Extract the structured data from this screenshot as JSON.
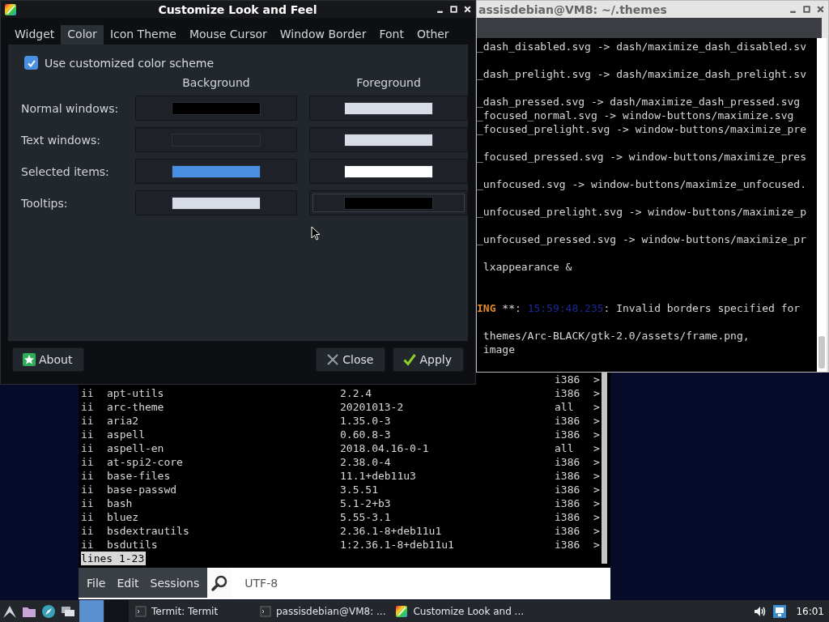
{
  "terminal_back": {
    "title": "assisdebian@VM8: ~/.themes",
    "lines": [
      {
        "kind": "text",
        "text": "_dash_disabled.svg -> dash/maximize_dash_disabled.sv"
      },
      {
        "kind": "blank"
      },
      {
        "kind": "text",
        "text": "_dash_prelight.svg -> dash/maximize_dash_prelight.sv"
      },
      {
        "kind": "blank"
      },
      {
        "kind": "text",
        "text": "_dash_pressed.svg -> dash/maximize_dash_pressed.svg"
      },
      {
        "kind": "text",
        "text": "_focused_normal.svg -> window-buttons/maximize.svg"
      },
      {
        "kind": "text",
        "text": "_focused_prelight.svg -> window-buttons/maximize_pre"
      },
      {
        "kind": "blank"
      },
      {
        "kind": "text",
        "text": "_focused_pressed.svg -> window-buttons/maximize_pres"
      },
      {
        "kind": "blank"
      },
      {
        "kind": "text",
        "text": "_unfocused.svg -> window-buttons/maximize_unfocused."
      },
      {
        "kind": "blank"
      },
      {
        "kind": "text",
        "text": "_unfocused_prelight.svg -> window-buttons/maximize_p"
      },
      {
        "kind": "blank"
      },
      {
        "kind": "text",
        "text": "_unfocused_pressed.svg -> window-buttons/maximize_pr"
      },
      {
        "kind": "blank"
      },
      {
        "kind": "text",
        "text": " lxappearance &"
      },
      {
        "kind": "blank"
      },
      {
        "kind": "blank"
      },
      {
        "kind": "warning",
        "level": "ING",
        "marker": " **: ",
        "stamp": "15:59:48.235",
        "message": ": Invalid borders specified for"
      },
      {
        "kind": "blank"
      },
      {
        "kind": "text",
        "text": " themes/Arc-BLACK/gtk-2.0/assets/frame.png,"
      },
      {
        "kind": "text",
        "text": " image"
      }
    ]
  },
  "terminal_front": {
    "rows": [
      {
        "arch": "i386",
        "more": ">"
      },
      {
        "status": "ii",
        "name": "apt-utils",
        "version": "2.2.4",
        "arch": "i386",
        "more": ">"
      },
      {
        "status": "ii",
        "name": "arc-theme",
        "version": "20201013-2",
        "arch": "all",
        "more": ">"
      },
      {
        "status": "ii",
        "name": "aria2",
        "version": "1.35.0-3",
        "arch": "i386",
        "more": ">"
      },
      {
        "status": "ii",
        "name": "aspell",
        "version": "0.60.8-3",
        "arch": "i386",
        "more": ">"
      },
      {
        "status": "ii",
        "name": "aspell-en",
        "version": "2018.04.16-0-1",
        "arch": "all",
        "more": ">"
      },
      {
        "status": "ii",
        "name": "at-spi2-core",
        "version": "2.38.0-4",
        "arch": "i386",
        "more": ">"
      },
      {
        "status": "ii",
        "name": "base-files",
        "version": "11.1+deb11u3",
        "arch": "i386",
        "more": ">"
      },
      {
        "status": "ii",
        "name": "base-passwd",
        "version": "3.5.51",
        "arch": "i386",
        "more": ">"
      },
      {
        "status": "ii",
        "name": "bash",
        "version": "5.1-2+b3",
        "arch": "i386",
        "more": ">"
      },
      {
        "status": "ii",
        "name": "bluez",
        "version": "5.55-3.1",
        "arch": "i386",
        "more": ">"
      },
      {
        "status": "ii",
        "name": "bsdextrautils",
        "version": "2.36.1-8+deb11u1",
        "arch": "i386",
        "more": ">"
      },
      {
        "status": "ii",
        "name": "bsdutils",
        "version": "1:2.36.1-8+deb11u1",
        "arch": "i386",
        "more": ">"
      }
    ],
    "pager_status": "lines 1-23",
    "menu": [
      "File",
      "Edit",
      "Sessions"
    ],
    "encoding": "UTF-8"
  },
  "dialog": {
    "title": "Customize Look and Feel",
    "tabs": [
      {
        "label": "Widget",
        "selected": false
      },
      {
        "label": "Color",
        "selected": true
      },
      {
        "label": "Icon Theme",
        "selected": false
      },
      {
        "label": "Mouse Cursor",
        "selected": false
      },
      {
        "label": "Window Border",
        "selected": false
      },
      {
        "label": "Font",
        "selected": false
      },
      {
        "label": "Other",
        "selected": false
      }
    ],
    "custom_scheme": {
      "label": "Use customized color scheme",
      "checked": true
    },
    "columns": [
      "Background",
      "Foreground"
    ],
    "color_rows": [
      {
        "label": "Normal windows:",
        "swatches": [
          {
            "color": "#000000",
            "focused": false
          },
          {
            "color": "#d8dce6",
            "focused": false
          }
        ]
      },
      {
        "label": "Text windows:",
        "swatches": [
          {
            "color": "#1e2228",
            "focused": false
          },
          {
            "color": "#d8dce6",
            "focused": false
          }
        ]
      },
      {
        "label": "Selected items:",
        "swatches": [
          {
            "color": "#4a90e2",
            "focused": false
          },
          {
            "color": "#ffffff",
            "focused": false
          }
        ]
      },
      {
        "label": "Tooltips:",
        "swatches": [
          {
            "color": "#d8dce6",
            "focused": false
          },
          {
            "color": "#000000",
            "focused": true
          }
        ]
      }
    ],
    "buttons": [
      {
        "label": "About",
        "kind": "about"
      },
      {
        "label": "Close",
        "kind": "close"
      },
      {
        "label": "Apply",
        "kind": "apply"
      }
    ]
  },
  "taskbar": {
    "workspaces": [
      {
        "selected": true
      },
      {
        "selected": false
      }
    ],
    "tasks": [
      {
        "label": "Termit: Termit",
        "kind": "terminal"
      },
      {
        "label": "passisdebian@VM8: ...",
        "kind": "terminal"
      },
      {
        "label": "Customize Look and ...",
        "kind": "appearance"
      }
    ],
    "clock": "16:01"
  }
}
